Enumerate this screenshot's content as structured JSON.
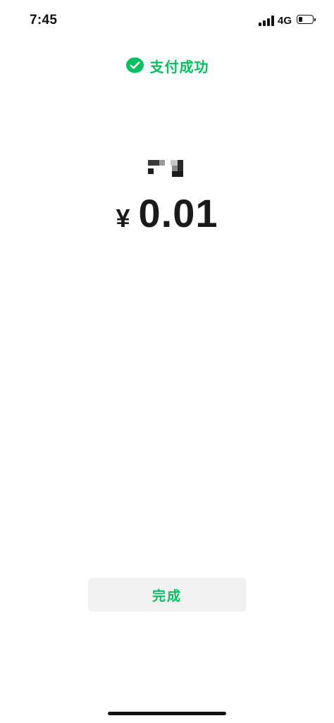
{
  "status_bar": {
    "time": "7:45",
    "network": "4G",
    "battery_level_fraction": 0.3
  },
  "header": {
    "icon": "wechat-pay-icon",
    "title": "支付成功"
  },
  "payment": {
    "merchant_redacted": true,
    "currency_symbol": "¥",
    "amount": "0.01"
  },
  "actions": {
    "done_label": "完成"
  },
  "colors": {
    "accent": "#07c160",
    "text": "#1a1a1a",
    "button_bg": "#f2f2f2"
  }
}
